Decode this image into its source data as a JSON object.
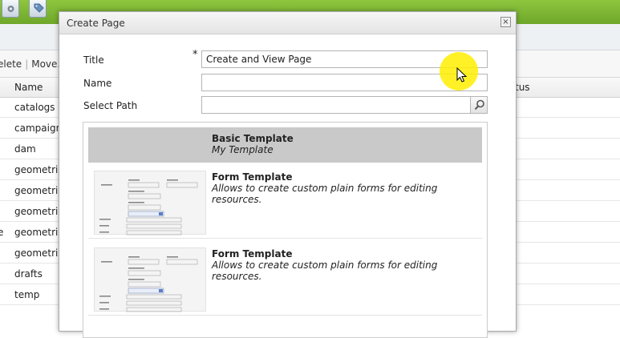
{
  "app": {
    "toolbar_icons": [
      "gear-icon",
      "tag-icon"
    ],
    "action_labels": [
      "elete",
      "Move."
    ],
    "column_headers": {
      "name": "Name",
      "status": "tus"
    },
    "rows": [
      {
        "name": "catalogs",
        "left": ""
      },
      {
        "name": "campaigns",
        "left": ""
      },
      {
        "name": "dam",
        "left": ""
      },
      {
        "name": "geometrix:",
        "left": ""
      },
      {
        "name": "geometrix:",
        "left": ""
      },
      {
        "name": "geometrix:",
        "left": ""
      },
      {
        "name": "geometrix:",
        "left": "e"
      },
      {
        "name": "geometrix:",
        "left": ""
      },
      {
        "name": "drafts",
        "left": ""
      },
      {
        "name": "temp",
        "left": ""
      }
    ]
  },
  "dialog": {
    "title": "Create Page",
    "close_glyph": "×",
    "required_marker": "*",
    "fields": {
      "title": {
        "label": "Title",
        "value": "Create and View Page"
      },
      "name": {
        "label": "Name",
        "value": ""
      },
      "path": {
        "label": "Select Path",
        "value": ""
      }
    },
    "templates": [
      {
        "name": "Basic Template",
        "description": "My Template",
        "selected": true
      },
      {
        "name": "Form Template",
        "description": "Allows to create custom plain forms for editing resources.",
        "selected": false
      },
      {
        "name": "Form Template",
        "description": "Allows to create custom plain forms for editing resources.",
        "selected": false
      }
    ]
  },
  "colors": {
    "topbar": "#7cb733",
    "selected_template": "#c9c9c9",
    "cursor_highlight": "#ffee00"
  }
}
